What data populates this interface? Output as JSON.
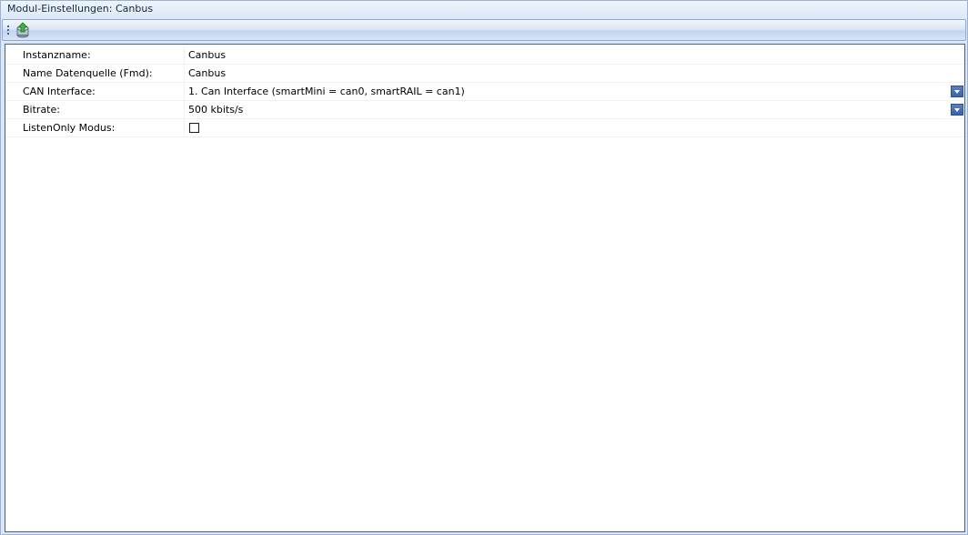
{
  "window": {
    "title": "Modul-Einstellungen: Canbus"
  },
  "toolbar": {
    "buttons": [
      {
        "icon": "upload-database-icon"
      }
    ]
  },
  "properties": {
    "rows": [
      {
        "label": "Instanzname:",
        "value": "Canbus",
        "type": "text"
      },
      {
        "label": "Name Datenquelle (Fmd):",
        "value": "Canbus",
        "type": "text"
      },
      {
        "label": "CAN Interface:",
        "value": "1. Can Interface (smartMini = can0, smartRAIL = can1)",
        "type": "dropdown"
      },
      {
        "label": "Bitrate:",
        "value": "500 kbits/s",
        "type": "dropdown"
      },
      {
        "label": "ListenOnly Modus:",
        "value": false,
        "type": "checkbox"
      }
    ]
  },
  "colors": {
    "accent": "#3a63ad",
    "panel_border": "#4a6180",
    "background": "#dbe7f7"
  }
}
